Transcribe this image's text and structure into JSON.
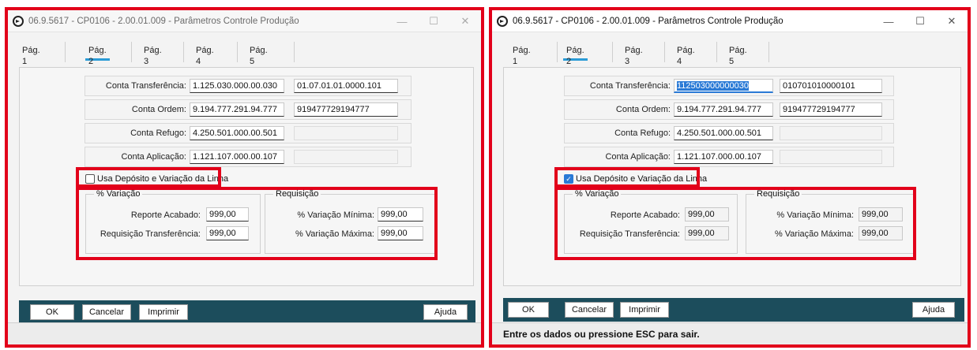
{
  "left_window": {
    "title": "06.9.5617 - CP0106 - 2.00.01.009 - Parâmetros Controle Produção",
    "window_controls": {
      "minimize": "—",
      "maximize": "☐",
      "close": "✕"
    },
    "tabs": [
      "Pág. 1",
      "Pág. 2",
      "Pág. 3",
      "Pág. 4",
      "Pág. 5"
    ],
    "active_tab": "Pág. 2",
    "fields": {
      "transferencia_label": "Conta Transferência:",
      "transferencia_value": "1.125.030.000.00.030",
      "transferencia_code": "01.07.01.01.0000.101",
      "ordem_label": "Conta Ordem:",
      "ordem_value": "9.194.777.291.94.777",
      "ordem_code": "919477729194777",
      "refugo_label": "Conta Refugo:",
      "refugo_value": "4.250.501.000.00.501",
      "aplicacao_label": "Conta Aplicação:",
      "aplicacao_value": "1.121.107.000.00.107"
    },
    "checkbox_label": "Usa Depósito e Variação da Linha",
    "checkbox_checked": false,
    "variacao_group": "% Variação",
    "reporte_label": "Reporte Acabado:",
    "reporte_value": "999,00",
    "req_transf_label": "Requisição Transferência:",
    "req_transf_value": "999,00",
    "requisicao_group": "Requisição",
    "var_min_label": "% Variação Mínima:",
    "var_min_value": "999,00",
    "var_max_label": "% Variação Máxima:",
    "var_max_value": "999,00",
    "buttons": {
      "ok": "OK",
      "cancel": "Cancelar",
      "print": "Imprimir",
      "help": "Ajuda"
    }
  },
  "right_window": {
    "title": "06.9.5617 - CP0106 - 2.00.01.009 - Parâmetros Controle Produção",
    "window_controls": {
      "minimize": "—",
      "maximize": "☐",
      "close": "✕"
    },
    "tabs": [
      "Pág. 1",
      "Pág. 2",
      "Pág. 3",
      "Pág. 4",
      "Pág. 5"
    ],
    "active_tab": "Pág. 2",
    "fields": {
      "transferencia_label": "Conta Transferência:",
      "transferencia_value": "112503000000030",
      "transferencia_code": "010701010000101",
      "ordem_label": "Conta Ordem:",
      "ordem_value": "9.194.777.291.94.777",
      "ordem_code": "919477729194777",
      "refugo_label": "Conta Refugo:",
      "refugo_value": "4.250.501.000.00.501",
      "aplicacao_label": "Conta Aplicação:",
      "aplicacao_value": "1.121.107.000.00.107"
    },
    "checkbox_label": "Usa Depósito e Variação da Linha",
    "checkbox_checked": true,
    "variacao_group": "% Variação",
    "reporte_label": "Reporte Acabado:",
    "reporte_value": "999,00",
    "req_transf_label": "Requisição Transferência:",
    "req_transf_value": "999,00",
    "requisicao_group": "Requisição",
    "var_min_label": "% Variação Mínima:",
    "var_min_value": "999,00",
    "var_max_label": "% Variação Máxima:",
    "var_max_value": "999,00",
    "buttons": {
      "ok": "OK",
      "cancel": "Cancelar",
      "print": "Imprimir",
      "help": "Ajuda"
    },
    "status_text": "Entre os dados ou pressione ESC para sair."
  },
  "colors": {
    "highlight": "#e2001a",
    "footer": "#1c4d5c",
    "accent": "#2a9bd6",
    "selection": "#2a7ad6"
  }
}
